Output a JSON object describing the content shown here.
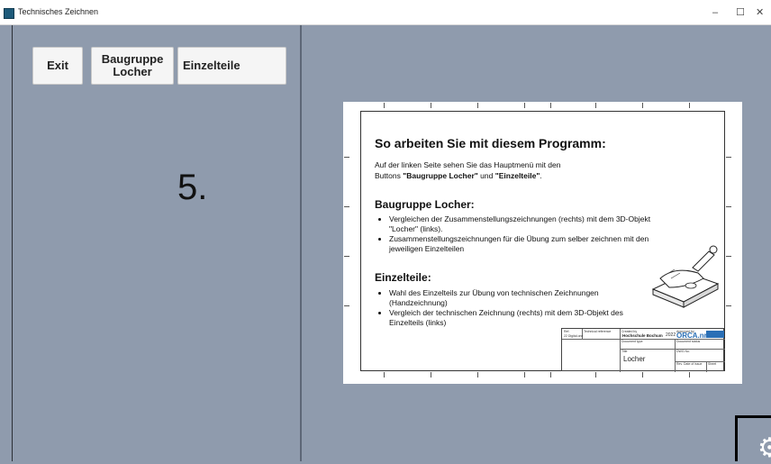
{
  "window": {
    "title": "Technisches Zeichnen",
    "min_glyph": "–",
    "max_glyph": "☐",
    "close_glyph": "✕"
  },
  "menu": {
    "exit_label": "Exit",
    "baugruppe_label": "Baugruppe\nLocher",
    "einzelteile_label": "Einzelteile"
  },
  "step_number": "5.",
  "instructions": {
    "title": "So arbeiten Sie mit diesem Programm:",
    "intro_1": "Auf der linken Seite sehen Sie das Hauptmenü mit den",
    "intro_2_prefix": "Buttons ",
    "intro_2_b1": "\"Baugruppe Locher\"",
    "intro_2_mid": " und ",
    "intro_2_b2": "\"Einzelteile\"",
    "intro_2_suffix": ".",
    "section1_title": "Baugruppe Locher:",
    "section1_items": [
      "Vergleichen der Zusammenstellungszeichnungen (rechts) mit dem 3D-Objekt \"Locher\" (links).",
      "Zusammenstellungszeichnungen für die Übung zum selber zeichnen mit den jeweiligen Einzelteilen"
    ],
    "section2_title": "Einzelteile:",
    "section2_items": [
      "Wahl des Einzelteils zur Übung von technischen Zeichnungen (Handzeichnung)",
      "Vergleich der technischen Zeichnung (rechts) mit dem 3D-Objekt des Einzelteils (links)"
    ]
  },
  "titleblock": {
    "school": "Hochschule Bochum",
    "year": "2022",
    "brand": "ORCA.nrw",
    "part_name": "Locher",
    "tiny_labels": [
      "Ref.",
      "Technical reference",
      "Created by",
      "Approved by",
      "Document type",
      "Document status",
      "Title",
      "DWG No.",
      "Rev.",
      "Date of issue",
      "Sheet"
    ],
    "origin": "22 Digital.one"
  },
  "colors": {
    "background": "#8f9bad",
    "accent": "#2a6fb6"
  },
  "icons": {
    "settings": "gear-icon",
    "app": "app-icon"
  }
}
